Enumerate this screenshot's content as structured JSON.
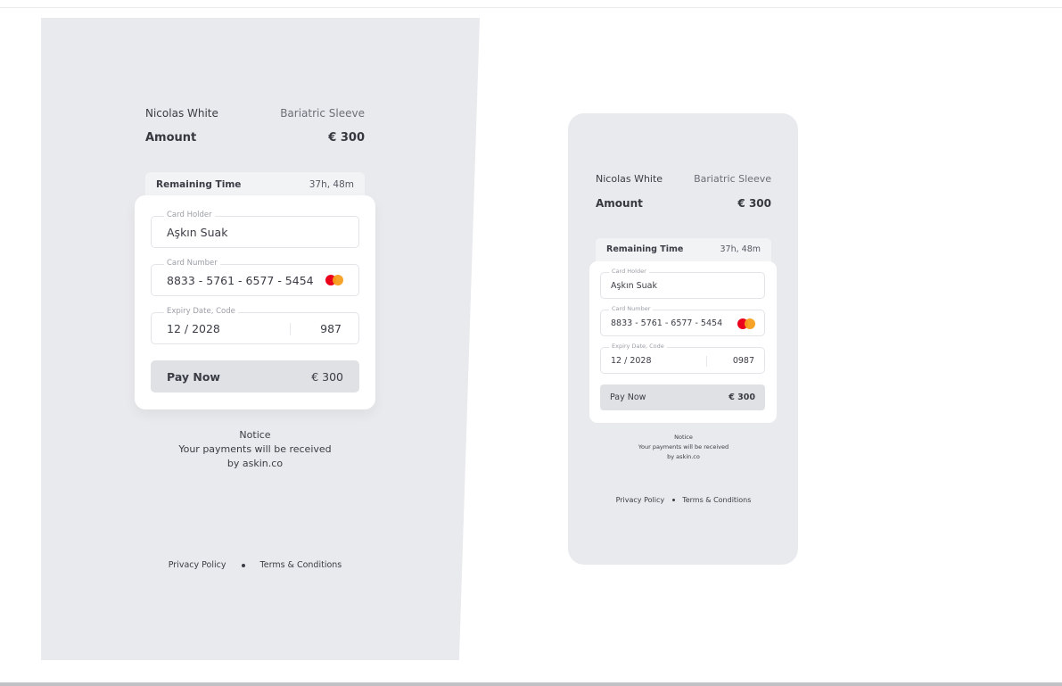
{
  "large": {
    "customer_name": "Nicolas White",
    "service": "Bariatric Sleeve",
    "amount_label": "Amount",
    "amount_value": "€ 300",
    "remaining_label": "Remaining Time",
    "remaining_value": "37h, 48m",
    "card_holder_label": "Card Holder",
    "card_holder_value": "Aşkın Suak",
    "card_number_label": "Card Number",
    "card_number_value": "8833 - 5761 - 6577 - 5454",
    "expiry_label": "Expiry Date, Code",
    "expiry_value": "12 / 2028",
    "code_value": "987",
    "pay_label": "Pay Now",
    "pay_amount": "€ 300",
    "notice_title": "Notice",
    "notice_line1": "Your payments will be received",
    "notice_line2": "by askin.co",
    "privacy": "Privacy Policy",
    "terms": "Terms & Conditions"
  },
  "small": {
    "customer_name": "Nicolas White",
    "service": "Bariatric Sleeve",
    "amount_label": "Amount",
    "amount_value": "€ 300",
    "remaining_label": "Remaining Time",
    "remaining_value": "37h, 48m",
    "card_holder_label": "Card Holder",
    "card_holder_value": "Aşkın Suak",
    "card_number_label": "Card Number",
    "card_number_value": "8833 - 5761 - 6577 - 5454",
    "expiry_label": "Expiry Date, Code",
    "expiry_value": "12 / 2028",
    "code_value": "0987",
    "pay_label": "Pay Now",
    "pay_amount": "€ 300",
    "notice_title": "Notice",
    "notice_line1": "Your payments will be received",
    "notice_line2": "by askin.co",
    "privacy": "Privacy Policy",
    "terms": "Terms & Conditions"
  },
  "colors": {
    "panel_bg": "#e9eaed",
    "card_bg": "#ffffff",
    "pay_button_bg": "#dfe1e5",
    "mastercard_red": "#eb001b",
    "mastercard_yellow": "#f79e1b"
  },
  "icons": [
    "mastercard-icon"
  ]
}
